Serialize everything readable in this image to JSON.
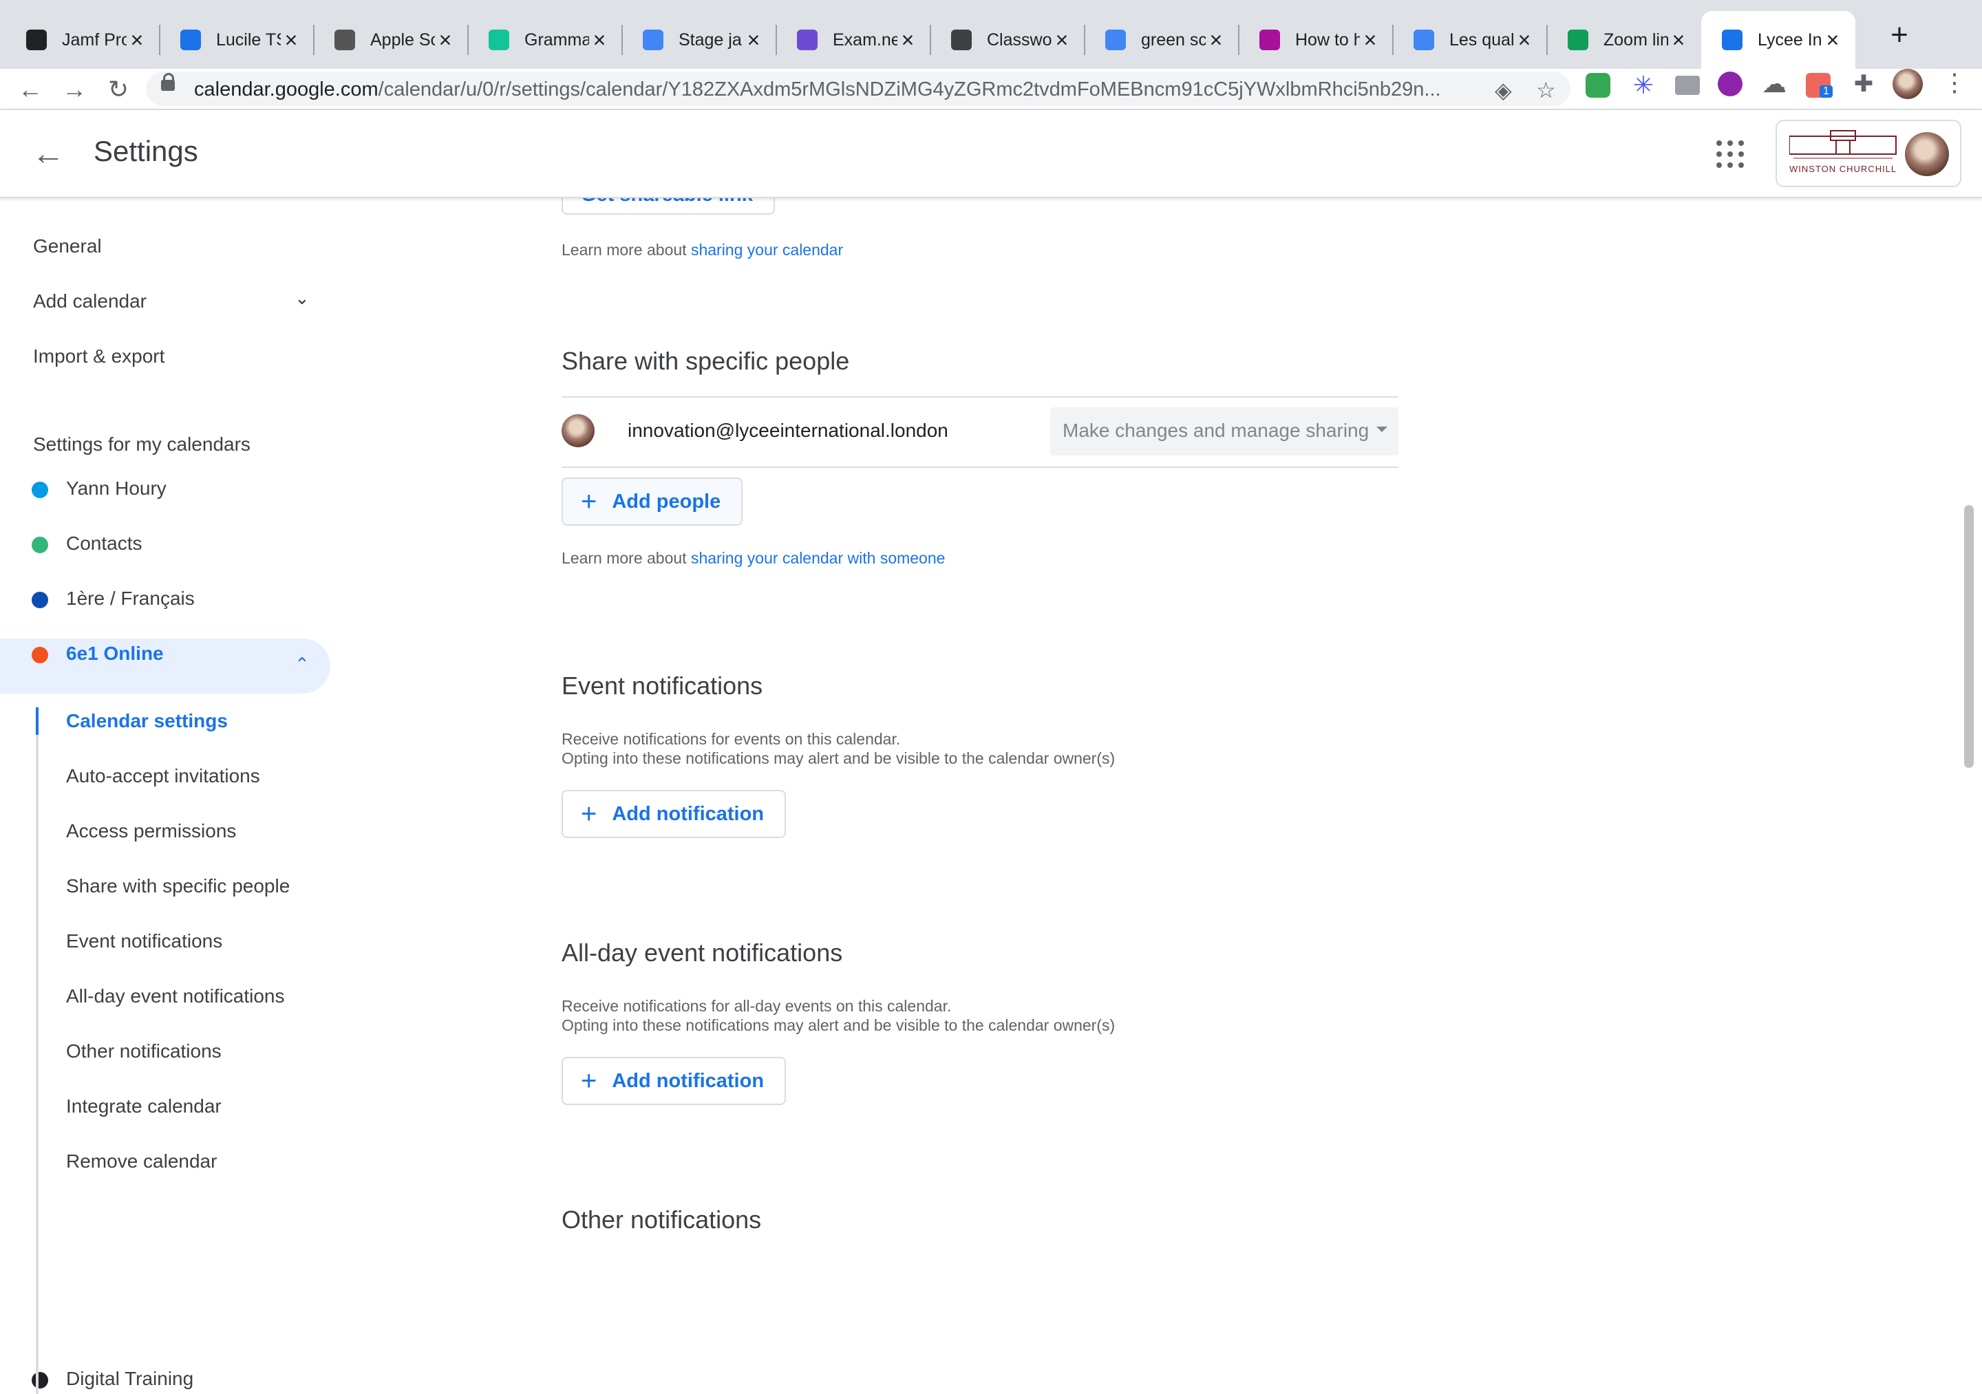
{
  "browser": {
    "tabs": [
      {
        "title": "Jamf Pro",
        "icon": "jamf-icon",
        "color": "#202124"
      },
      {
        "title": "Lucile TS",
        "icon": "hexagon-icon",
        "color": "#1a73e8"
      },
      {
        "title": "Apple Sc",
        "icon": "apple-icon",
        "color": "#555555"
      },
      {
        "title": "Gramma",
        "icon": "grammarly-icon",
        "color": "#15c39a"
      },
      {
        "title": "Stage ja",
        "icon": "google-docs-icon",
        "color": "#4285f4"
      },
      {
        "title": "Exam.ne",
        "icon": "exam-icon",
        "color": "#6d4bd1"
      },
      {
        "title": "Classwo",
        "icon": "classroom-icon",
        "color": "#3c4043"
      },
      {
        "title": "green sc",
        "icon": "google-icon",
        "color": "#4285f4"
      },
      {
        "title": "How to h",
        "icon": "vimeo-icon",
        "color": "#a7119b"
      },
      {
        "title": "Les qual",
        "icon": "google-docs-icon",
        "color": "#4285f4"
      },
      {
        "title": "Zoom lin",
        "icon": "google-sheets-icon",
        "color": "#0f9d58"
      },
      {
        "title": "Lycee In",
        "icon": "google-calendar-icon",
        "color": "#1a73e8",
        "active": true
      }
    ],
    "url_host": "calendar.google.com",
    "url_path": "/calendar/u/0/r/settings/calendar/Y182ZXAxdm5rMGlsNDZiMG4yZGRmc2tvdmFoMEBncm91cC5jYWxlbmRhci5nb29n...",
    "extension_badge": "1"
  },
  "header": {
    "title": "Settings",
    "org_name": "WINSTON CHURCHILL"
  },
  "sidebar": {
    "general": "General",
    "add_calendar": "Add calendar",
    "import_export": "Import & export",
    "my_calendars_heading": "Settings for my calendars",
    "calendars": [
      {
        "name": "Yann Houry",
        "color": "#039be5"
      },
      {
        "name": "Contacts",
        "color": "#33b679"
      },
      {
        "name": "1ère / Français",
        "color": "#0b4db0"
      },
      {
        "name": "6e1 Online",
        "color": "#f4511e",
        "selected": true
      },
      {
        "name": "Digital Training",
        "color": "#202124"
      }
    ],
    "sub_items": [
      "Calendar settings",
      "Auto-accept invitations",
      "Access permissions",
      "Share with specific people",
      "Event notifications",
      "All-day event notifications",
      "Other notifications",
      "Integrate calendar",
      "Remove calendar"
    ]
  },
  "main": {
    "shareable_link_btn": "Get shareable link",
    "learn_prefix": "Learn more about ",
    "sharing_link": "sharing your calendar",
    "share_heading": "Share with specific people",
    "person_email": "innovation@lyceeinternational.london",
    "permission": "Make changes and manage sharing",
    "add_people": "Add people",
    "sharing_someone_link": "sharing your calendar with someone",
    "event_notif_heading": "Event notifications",
    "event_notif_line1": "Receive notifications for events on this calendar.",
    "notif_line2": "Opting into these notifications may alert and be visible to the calendar owner(s)",
    "add_notification": "Add notification",
    "allday_heading": "All-day event notifications",
    "allday_line1": "Receive notifications for all-day events on this calendar.",
    "other_heading": "Other notifications"
  }
}
